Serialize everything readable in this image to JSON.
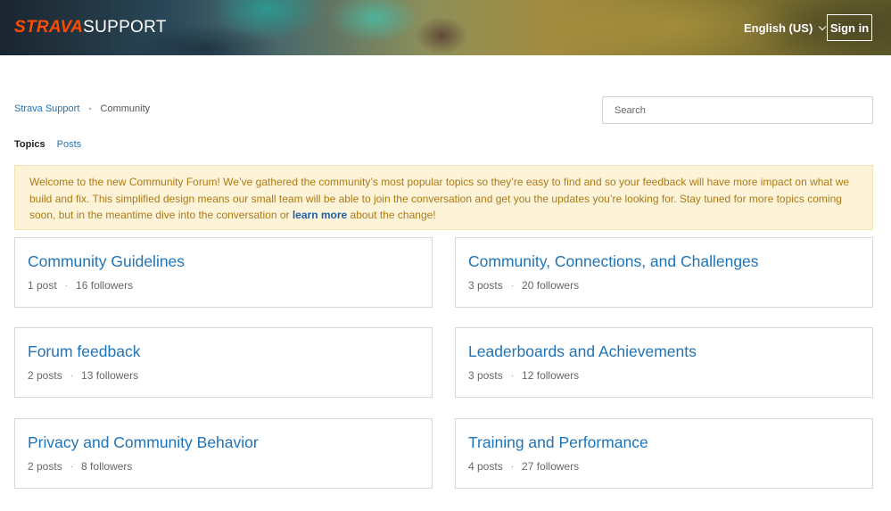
{
  "header": {
    "logo_brand": "STRAVA",
    "logo_suffix": "SUPPORT",
    "language": "English (US)",
    "sign_in": "Sign in"
  },
  "breadcrumb": {
    "home": "Strava Support",
    "current": "Community"
  },
  "search": {
    "placeholder": "Search"
  },
  "tabs": {
    "topics": "Topics",
    "posts": "Posts"
  },
  "notice": {
    "text_before": "Welcome to the new Community Forum! We’ve gathered the community’s most popular topics so they’re easy to find and so your feedback will have more impact on what we build and fix. This simplified design means our small team will be able to join the conversation and get you the updates you’re looking for. Stay tuned for more topics coming soon, but in the meantime dive into the conversation or ",
    "link": "learn more",
    "text_after": " about the change!"
  },
  "topics": [
    {
      "title": "Community Guidelines",
      "posts": "1 post",
      "followers": "16 followers"
    },
    {
      "title": "Community, Connections, and Challenges",
      "posts": "3 posts",
      "followers": "20 followers"
    },
    {
      "title": "Forum feedback",
      "posts": "2 posts",
      "followers": "13 followers"
    },
    {
      "title": "Leaderboards and Achievements",
      "posts": "3 posts",
      "followers": "12 followers"
    },
    {
      "title": "Privacy and Community Behavior",
      "posts": "2 posts",
      "followers": "8 followers"
    },
    {
      "title": "Training and Performance",
      "posts": "4 posts",
      "followers": "27 followers"
    }
  ],
  "colors": {
    "brand": "#fc4c02",
    "link": "#1f73b7",
    "notice_bg": "#fdf3d8",
    "notice_text": "#ad7a14"
  }
}
